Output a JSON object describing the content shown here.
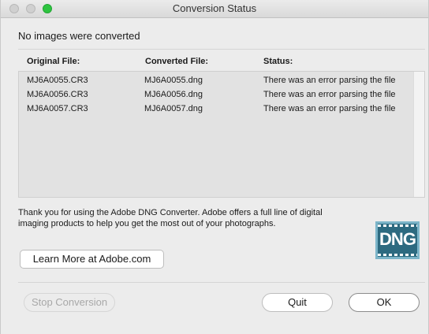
{
  "window": {
    "title": "Conversion Status"
  },
  "headline": "No images were converted",
  "table": {
    "columns": [
      "Original File:",
      "Converted File:",
      "Status:"
    ],
    "rows": [
      [
        "MJ6A0055.CR3",
        "MJ6A0055.dng",
        "There was an error parsing the file"
      ],
      [
        "MJ6A0056.CR3",
        "MJ6A0056.dng",
        "There was an error parsing the file"
      ],
      [
        "MJ6A0057.CR3",
        "MJ6A0057.dng",
        "There was an error parsing the file"
      ]
    ]
  },
  "message": {
    "line1": "Thank you for using the Adobe DNG Converter.  Adobe offers a full line of digital",
    "line2": "imaging products to help you get the most out of your photographs."
  },
  "logo": {
    "text": "DNG"
  },
  "buttons": {
    "learn_more": "Learn More at Adobe.com",
    "stop_conversion": "Stop Conversion",
    "quit": "Quit",
    "ok": "OK"
  },
  "colors": {
    "zoom_button": "#2ec440",
    "logo_background": "#2d6a80",
    "list_background": "#e2e2e2"
  }
}
